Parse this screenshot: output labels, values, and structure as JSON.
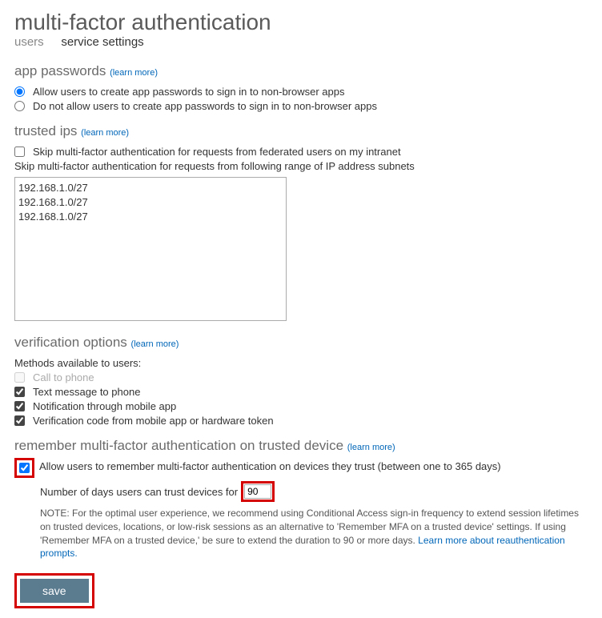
{
  "page_title": "multi-factor authentication",
  "tabs": {
    "users": "users",
    "service_settings": "service settings"
  },
  "app_passwords": {
    "title": "app passwords",
    "learn_more": "(learn more)",
    "opt_allow": "Allow users to create app passwords to sign in to non-browser apps",
    "opt_disallow": "Do not allow users to create app passwords to sign in to non-browser apps"
  },
  "trusted_ips": {
    "title": "trusted ips",
    "learn_more": "(learn more)",
    "skip_federated": "Skip multi-factor authentication for requests from federated users on my intranet",
    "range_label": "Skip multi-factor authentication for requests from following range of IP address subnets",
    "ip_list": "192.168.1.0/27\n192.168.1.0/27\n192.168.1.0/27"
  },
  "verification_options": {
    "title": "verification options",
    "learn_more": "(learn more)",
    "methods_label": "Methods available to users:",
    "call_to_phone": "Call to phone",
    "text_to_phone": "Text message to phone",
    "notification_app": "Notification through mobile app",
    "verification_code": "Verification code from mobile app or hardware token"
  },
  "remember_mfa": {
    "title": "remember multi-factor authentication on trusted device",
    "learn_more": "(learn more)",
    "allow_label": "Allow users to remember multi-factor authentication on devices they trust (between one to 365 days)",
    "days_label": "Number of days users can trust devices for",
    "days_value": "90",
    "note_prefix": "NOTE: For the optimal user experience, we recommend using Conditional Access sign-in frequency to extend session lifetimes on trusted devices, locations, or low-risk sessions as an alternative to 'Remember MFA on a trusted device' settings. If using 'Remember MFA on a trusted device,' be sure to extend the duration to 90 or more days. ",
    "note_link": "Learn more about reauthentication prompts."
  },
  "buttons": {
    "save": "save"
  }
}
